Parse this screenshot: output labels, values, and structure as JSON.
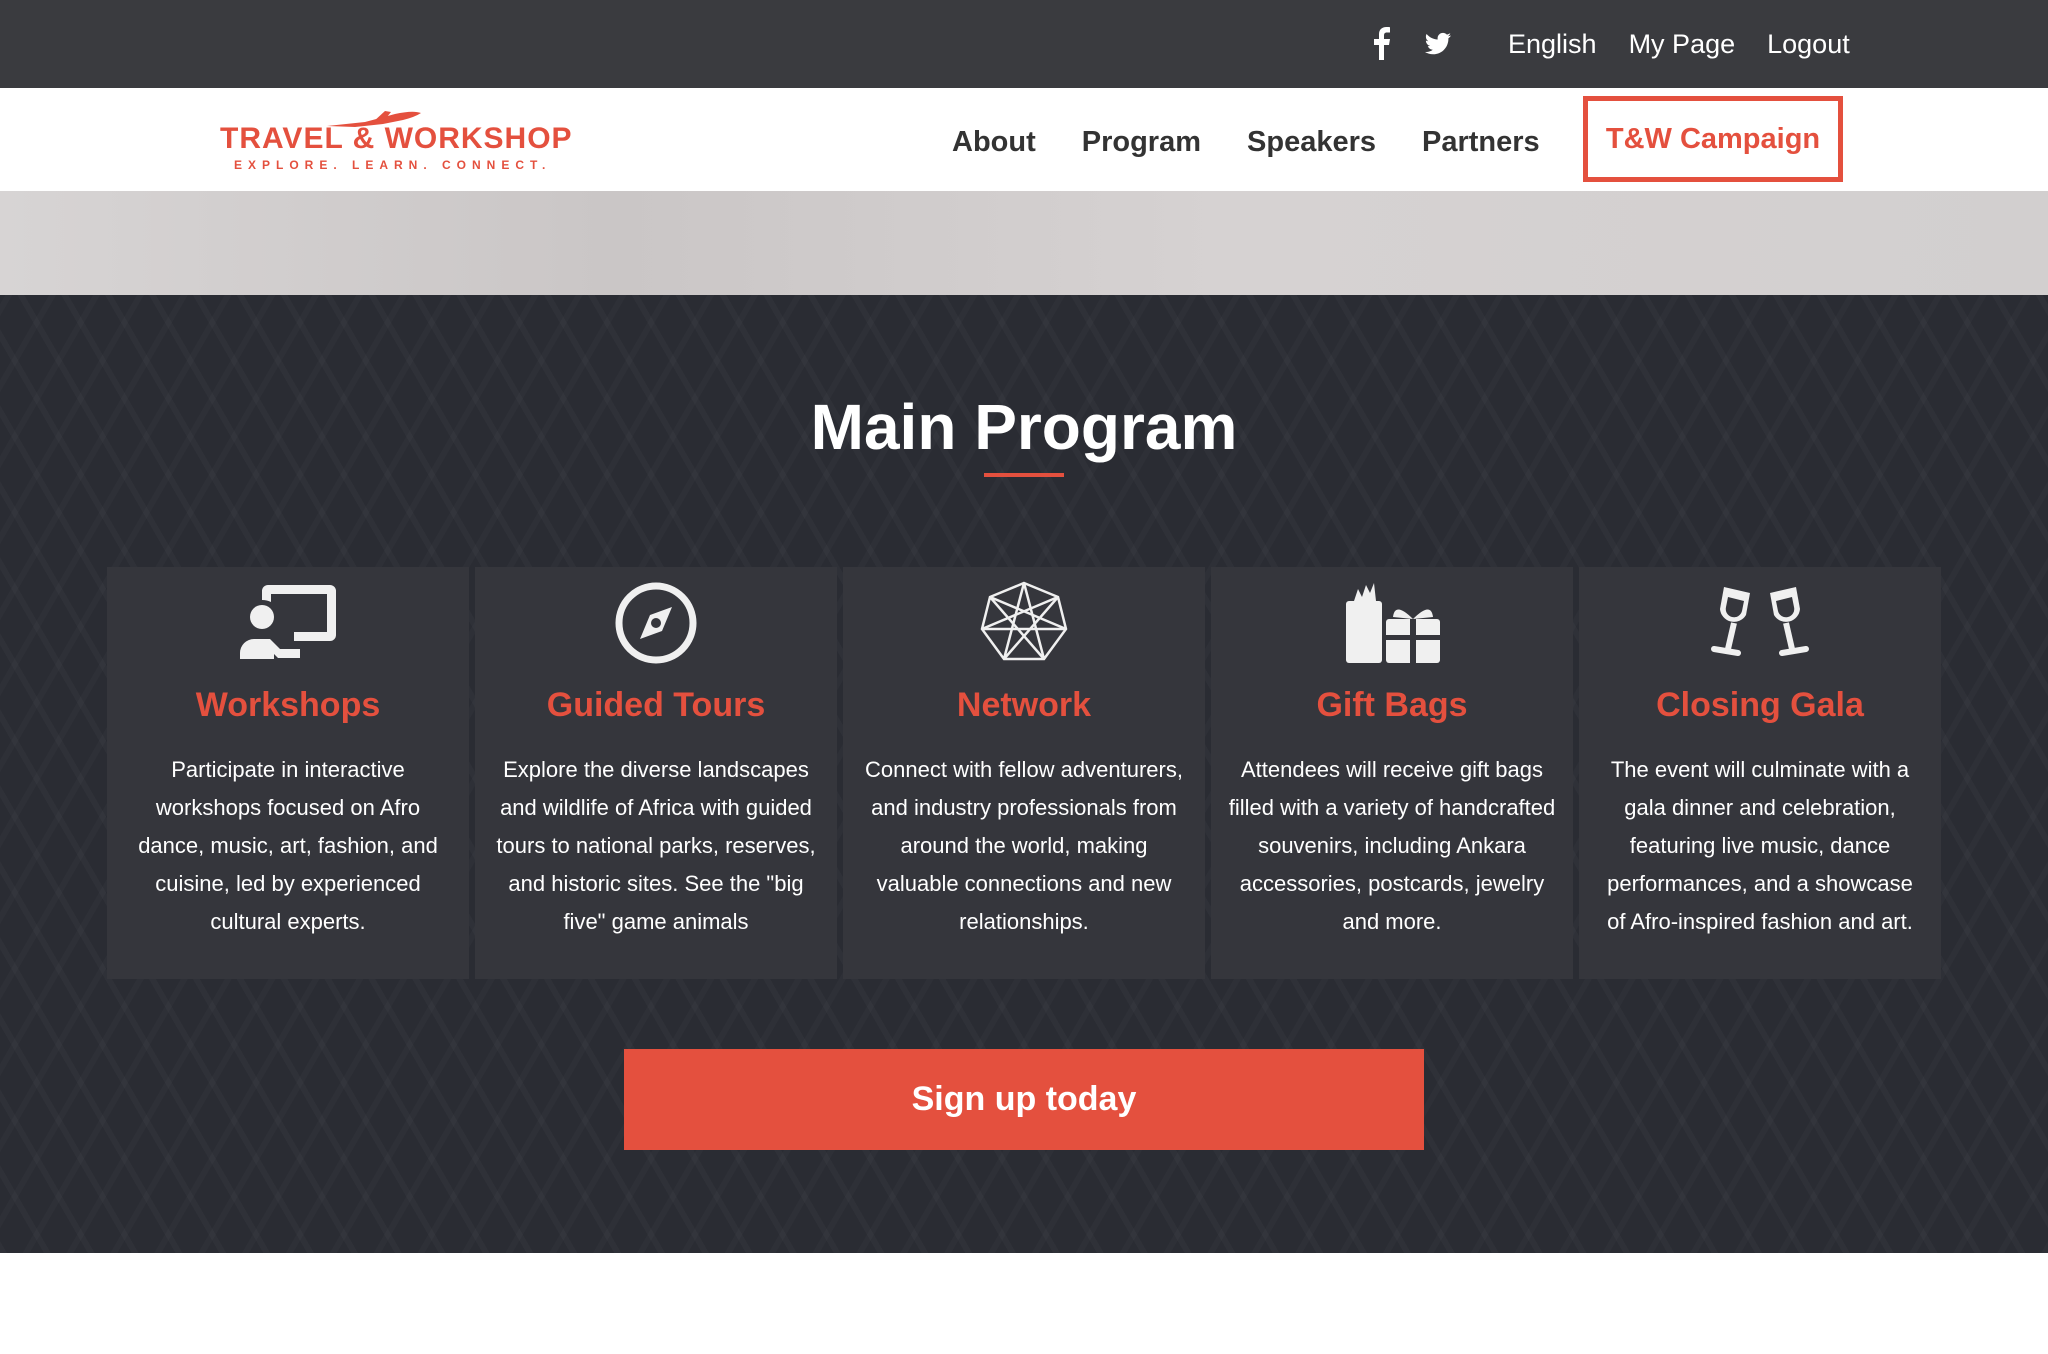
{
  "topbar": {
    "social": [
      {
        "icon": "facebook-icon"
      },
      {
        "icon": "twitter-icon"
      }
    ],
    "links": [
      "English",
      "My Page",
      "Logout"
    ]
  },
  "navbar": {
    "logo": {
      "main": "TRAVEL & WORKSHOP",
      "sub": "EXPLORE. LEARN. CONNECT."
    },
    "links": [
      "About",
      "Program",
      "Speakers",
      "Partners"
    ],
    "campaign": "T&W Campaign"
  },
  "program": {
    "title": "Main Program",
    "cards": [
      {
        "icon": "presentation-icon",
        "title": "Workshops",
        "text": "Participate in interactive workshops focused on Afro dance, music, art, fashion, and cuisine, led by experienced cultural experts."
      },
      {
        "icon": "compass-icon",
        "title": "Guided Tours",
        "text": "Explore the diverse landscapes and wildlife of Africa with guided tours to national parks, reserves, and historic sites. See the \"big five\" game animals"
      },
      {
        "icon": "network-icon",
        "title": "Network",
        "text": "Connect with fellow adventurers, and industry professionals from around the world, making valuable connections and new relationships."
      },
      {
        "icon": "gift-icon",
        "title": "Gift Bags",
        "text": "Attendees will receive gift bags filled with a variety of handcrafted souvenirs, including Ankara accessories, postcards, jewelry and more."
      },
      {
        "icon": "glasses-cheers-icon",
        "title": "Closing Gala",
        "text": "The event will culminate with a gala dinner and celebration, featuring live music, dance performances, and a showcase of Afro-inspired fashion and art."
      }
    ],
    "signup": "Sign up today"
  },
  "colors": {
    "accent": "#e4503e",
    "topbar": "#3a3b3f",
    "section_bg": "#2a2c33",
    "card_bg": "#35363c"
  }
}
